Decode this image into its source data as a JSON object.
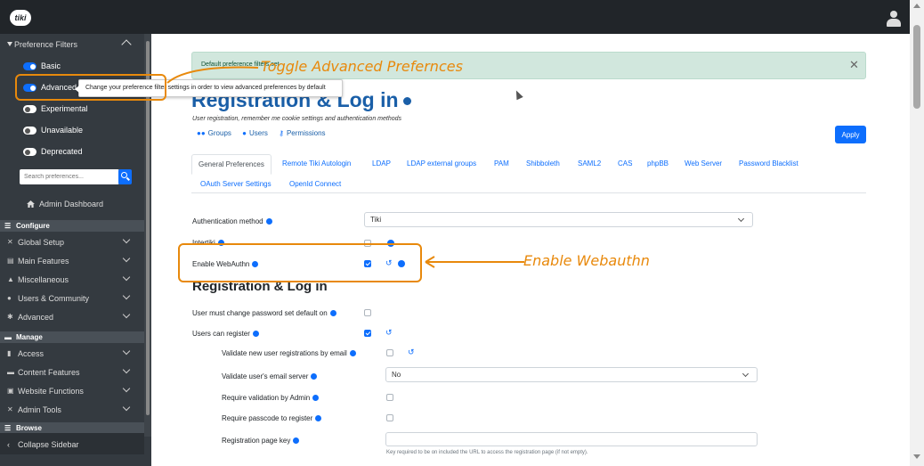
{
  "header": {
    "logo_text": "tiki",
    "user_icon": "user-icon"
  },
  "sidebar": {
    "preference_filters_label": "Preference Filters",
    "filters": [
      {
        "label": "Basic",
        "on": true
      },
      {
        "label": "Advanced",
        "on": true
      },
      {
        "label": "Experimental",
        "on": false
      },
      {
        "label": "Unavailable",
        "on": false
      },
      {
        "label": "Deprecated",
        "on": false
      }
    ],
    "search_placeholder": "Search preferences...",
    "admin_dashboard": "Admin Dashboard",
    "configure_label": "Configure",
    "configure_items": [
      "Global Setup",
      "Main Features",
      "Miscellaneous",
      "Users & Community",
      "Advanced"
    ],
    "manage_label": "Manage",
    "manage_items": [
      "Access",
      "Content Features",
      "Website Functions",
      "Admin Tools"
    ],
    "browse_label": "Browse",
    "collapse_label": "Collapse Sidebar"
  },
  "tooltip": {
    "text": "Change your preference filter settings in order to view advanced preferences by default"
  },
  "alert": {
    "message": "Default preference filters set"
  },
  "page": {
    "title": "Registration & Log in",
    "subtitle": "User registration, remember me cookie settings and authentication methods",
    "quick_links": [
      "Groups",
      "Users",
      "Permissions"
    ],
    "apply_label": "Apply"
  },
  "tabs": [
    "General Preferences",
    "Remote Tiki Autologin",
    "LDAP",
    "LDAP external groups",
    "PAM",
    "Shibboleth",
    "SAML2",
    "CAS",
    "phpBB",
    "Web Server",
    "Password Blacklist",
    "OAuth Server Settings",
    "OpenId Connect"
  ],
  "form": {
    "auth_method_label": "Authentication method",
    "auth_method_value": "Tiki",
    "intertiki_label": "Intertiki",
    "webauthn_label": "Enable WebAuthn",
    "section_title": "Registration & Log in",
    "must_change_pw_label": "User must change password set default on",
    "users_can_register_label": "Users can register",
    "validate_by_email_label": "Validate new user registrations by email",
    "validate_email_server_label": "Validate user's email server",
    "validate_email_server_value": "No",
    "require_admin_label": "Require validation by Admin",
    "require_passcode_label": "Require passcode to register",
    "reg_page_key_label": "Registration page key",
    "reg_page_key_hint": "Key required to be on included the URL to access the registration page (if not empty)."
  },
  "annotations": {
    "toggle_text": "Toggle Advanced Prefernces",
    "webauthn_text": "Enable Webauthn",
    "color": "#e8890c"
  }
}
